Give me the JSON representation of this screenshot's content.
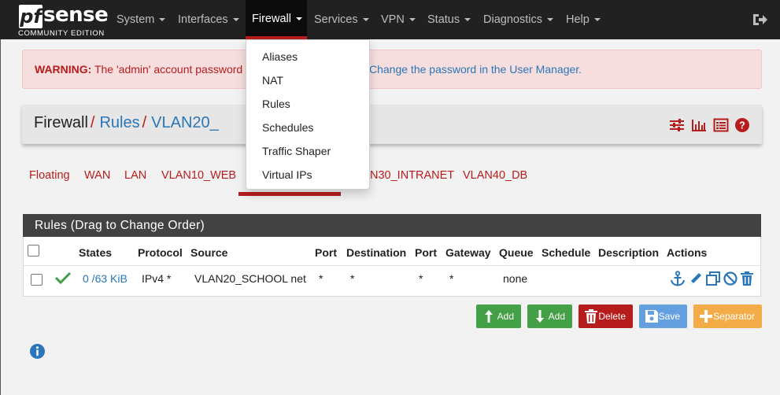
{
  "brand": {
    "logo_mark": "pf",
    "name": "sense",
    "edition": "COMMUNITY EDITION"
  },
  "nav": {
    "items": [
      {
        "label": "System"
      },
      {
        "label": "Interfaces"
      },
      {
        "label": "Firewall"
      },
      {
        "label": "Services"
      },
      {
        "label": "VPN"
      },
      {
        "label": "Status"
      },
      {
        "label": "Diagnostics"
      },
      {
        "label": "Help"
      }
    ],
    "active": "Firewall",
    "logout_icon": "sign-out-icon"
  },
  "firewall_menu": {
    "items": [
      "Aliases",
      "NAT",
      "Rules",
      "Schedules",
      "Traffic Shaper",
      "Virtual IPs"
    ]
  },
  "warning": {
    "prefix": "WARNING:",
    "text": "The 'admin' account password is",
    "link": "Change the password in the User Manager."
  },
  "breadcrumb": {
    "items": [
      "Firewall",
      "Rules",
      "VLAN20_"
    ],
    "separator": "/"
  },
  "tabs": {
    "items": [
      "Floating",
      "WAN",
      "LAN",
      "VLAN10_WEB",
      "N30_INTRANET",
      "VLAN40_DB"
    ]
  },
  "panel": {
    "title": "Rules (Drag to Change Order)"
  },
  "table": {
    "headers": [
      "States",
      "Protocol",
      "Source",
      "Port",
      "Destination",
      "Port",
      "Gateway",
      "Queue",
      "Schedule",
      "Description",
      "Actions"
    ],
    "rows": [
      {
        "status_icon": "check-icon",
        "states": "0 /63 KiB",
        "protocol": "IPv4 *",
        "source": "VLAN20_SCHOOL net",
        "source_port": "*",
        "destination": "*",
        "destination_port": "*",
        "gateway": "*",
        "queue": "none",
        "schedule": "",
        "description": ""
      }
    ]
  },
  "buttons": {
    "add_top": "Add",
    "add_bottom": "Add",
    "delete": "Delete",
    "save": "Save",
    "separator": "Separator"
  },
  "colors": {
    "navbar": "#212121",
    "accent_red": "#b71c1c",
    "link_blue": "#2a76b8",
    "success_green": "#43a047",
    "delete_red": "#b71c1c",
    "save_blue": "#64a0e0",
    "separator_orange": "#f3ac48"
  }
}
